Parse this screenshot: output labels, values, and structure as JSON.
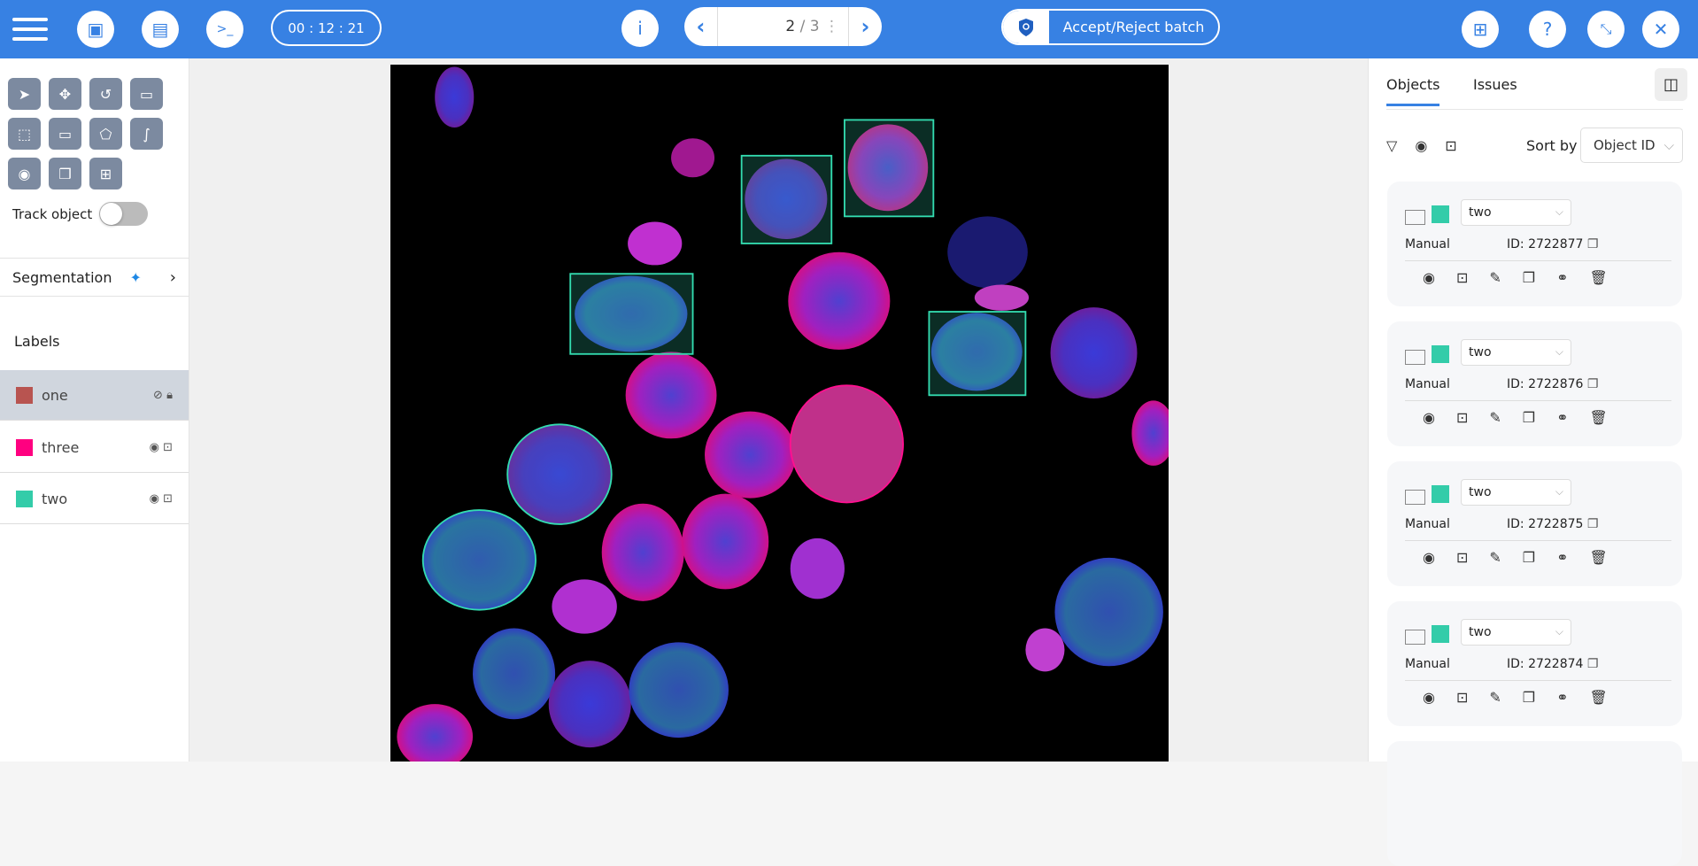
{
  "header": {
    "timer": "00 : 12 : 21",
    "page_current": "2",
    "page_sep": "/ 3",
    "accept_label": "Accept/Reject batch"
  },
  "tools": {
    "track_object": "Track object",
    "segmentation": "Segmentation"
  },
  "labels": {
    "title": "Labels",
    "items": [
      {
        "name": "one",
        "color": "#b85450"
      },
      {
        "name": "three",
        "color": "#ff0080"
      },
      {
        "name": "two",
        "color": "#33cca9"
      }
    ]
  },
  "objects": {
    "tabs": [
      "Objects",
      "Issues"
    ],
    "sort_label": "Sort by",
    "sort_value": "Object ID",
    "cards": [
      {
        "label": "two",
        "source": "Manual",
        "id": "ID: 2722877"
      },
      {
        "label": "two",
        "source": "Manual",
        "id": "ID: 2722876"
      },
      {
        "label": "two",
        "source": "Manual",
        "id": "ID: 2722875"
      },
      {
        "label": "two",
        "source": "Manual",
        "id": "ID: 2722874"
      }
    ]
  }
}
